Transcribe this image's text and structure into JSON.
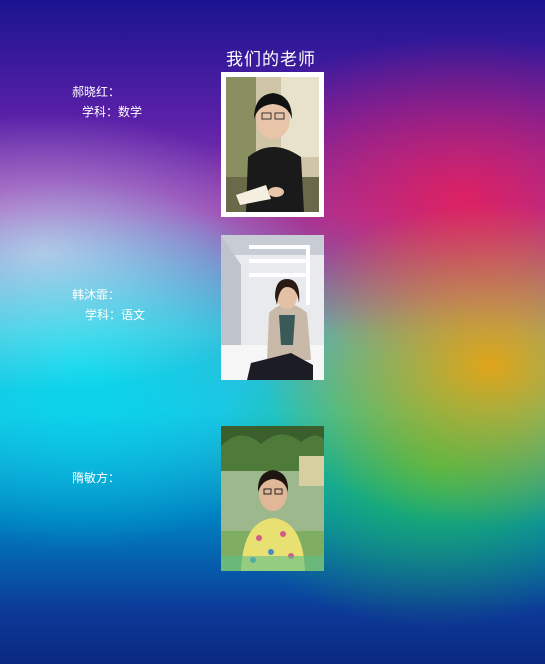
{
  "page": {
    "title": "我们的老师"
  },
  "teachers": [
    {
      "name": "郝晓红：",
      "subject": "学科：数学"
    },
    {
      "name": "韩沐霏：",
      "subject": "学科：语文"
    },
    {
      "name": "隋敏方：",
      "subject": ""
    }
  ],
  "colors": {
    "text": "#ffffff",
    "gradient_top": "#1a1490",
    "gradient_mid": "#22c0e0",
    "gradient_bottom": "#0a2880"
  }
}
